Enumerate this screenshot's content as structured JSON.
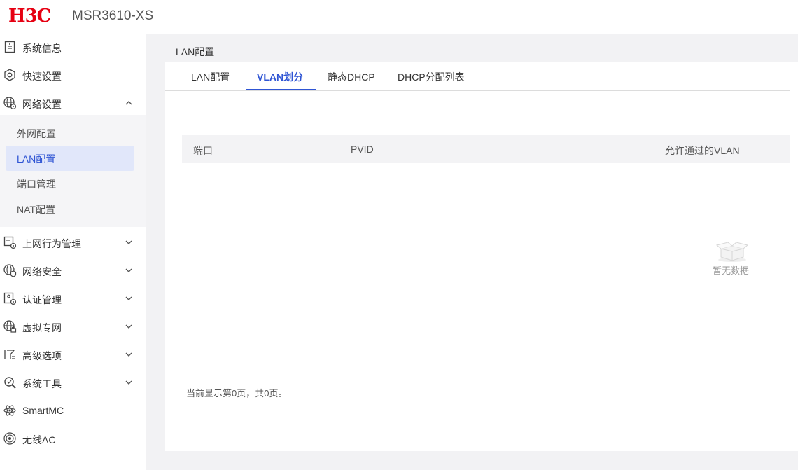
{
  "header": {
    "logo": "H3C",
    "model": "MSR3610-XS"
  },
  "sidebar": {
    "items": [
      {
        "label": "系统信息",
        "icon": "system-info-icon"
      },
      {
        "label": "快速设置",
        "icon": "quick-setup-icon"
      },
      {
        "label": "网络设置",
        "icon": "network-settings-icon",
        "expanded": true
      },
      {
        "label": "上网行为管理",
        "icon": "behavior-management-icon"
      },
      {
        "label": "网络安全",
        "icon": "network-security-icon"
      },
      {
        "label": "认证管理",
        "icon": "auth-management-icon"
      },
      {
        "label": "虚拟专网",
        "icon": "vpn-icon"
      },
      {
        "label": "高级选项",
        "icon": "advanced-options-icon"
      },
      {
        "label": "系统工具",
        "icon": "system-tools-icon"
      },
      {
        "label": "SmartMC",
        "icon": "smartmc-icon"
      },
      {
        "label": "无线AC",
        "icon": "wireless-ac-icon"
      }
    ],
    "subitems": [
      {
        "label": "外网配置"
      },
      {
        "label": "LAN配置",
        "active": true
      },
      {
        "label": "端口管理"
      },
      {
        "label": "NAT配置"
      }
    ]
  },
  "main": {
    "title": "LAN配置",
    "tabs": [
      {
        "label": "LAN配置"
      },
      {
        "label": "VLAN划分",
        "active": true
      },
      {
        "label": "静态DHCP"
      },
      {
        "label": "DHCP分配列表"
      }
    ],
    "table": {
      "columns": [
        "端口",
        "PVID",
        "允许通过的VLAN"
      ],
      "empty_text": "暂无数据"
    },
    "pager_text": "当前显示第0页，共0页。"
  },
  "colors": {
    "brand": "#e60012",
    "accent": "#2f55d4",
    "active_bg": "#e1e7fa"
  }
}
